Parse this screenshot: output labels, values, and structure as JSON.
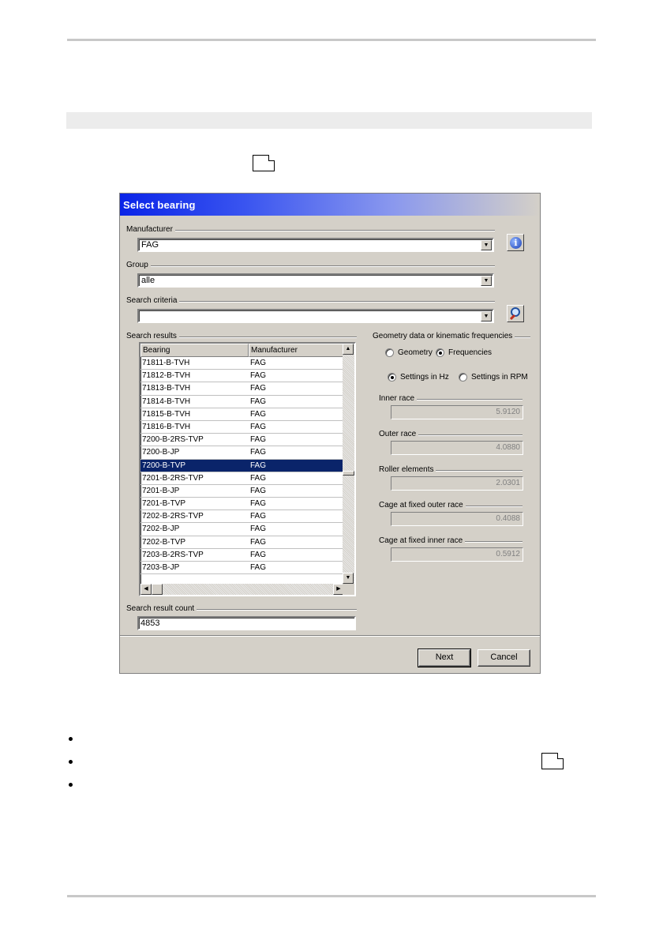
{
  "dialog": {
    "title": "Select bearing",
    "manufacturer": {
      "label": "Manufacturer",
      "value": "FAG"
    },
    "group": {
      "label": "Group",
      "value": "alle"
    },
    "search_criteria": {
      "label": "Search criteria",
      "value": ""
    },
    "search_results": {
      "label": "Search results",
      "columns": [
        "Bearing",
        "Manufacturer"
      ],
      "rows": [
        [
          "71811-B-TVH",
          "FAG"
        ],
        [
          "71812-B-TVH",
          "FAG"
        ],
        [
          "71813-B-TVH",
          "FAG"
        ],
        [
          "71814-B-TVH",
          "FAG"
        ],
        [
          "71815-B-TVH",
          "FAG"
        ],
        [
          "71816-B-TVH",
          "FAG"
        ],
        [
          "7200-B-2RS-TVP",
          "FAG"
        ],
        [
          "7200-B-JP",
          "FAG"
        ],
        [
          "7200-B-TVP",
          "FAG"
        ],
        [
          "7201-B-2RS-TVP",
          "FAG"
        ],
        [
          "7201-B-JP",
          "FAG"
        ],
        [
          "7201-B-TVP",
          "FAG"
        ],
        [
          "7202-B-2RS-TVP",
          "FAG"
        ],
        [
          "7202-B-JP",
          "FAG"
        ],
        [
          "7202-B-TVP",
          "FAG"
        ],
        [
          "7203-B-2RS-TVP",
          "FAG"
        ],
        [
          "7203-B-JP",
          "FAG"
        ]
      ],
      "selected_index": 8
    },
    "search_result_count": {
      "label": "Search result count",
      "value": "4853"
    },
    "geometry": {
      "label": "Geometry data or kinematic frequencies",
      "mode_options": [
        "Geometry",
        "Frequencies"
      ],
      "mode_selected": "Frequencies",
      "unit_options": [
        "Settings in Hz",
        "Settings in RPM"
      ],
      "unit_selected": "Settings in Hz",
      "fields": [
        {
          "label": "Inner race",
          "value": "5.9120"
        },
        {
          "label": "Outer race",
          "value": "4.0880"
        },
        {
          "label": "Roller elements",
          "value": "2.0301"
        },
        {
          "label": "Cage at fixed outer race",
          "value": "0.4088"
        },
        {
          "label": "Cage at fixed inner race",
          "value": "0.5912"
        }
      ]
    },
    "buttons": {
      "next": "Next",
      "cancel": "Cancel"
    }
  },
  "icons": {
    "info": "info-icon",
    "search": "magnifier-icon",
    "dropdown": "chevron-down-icon"
  }
}
